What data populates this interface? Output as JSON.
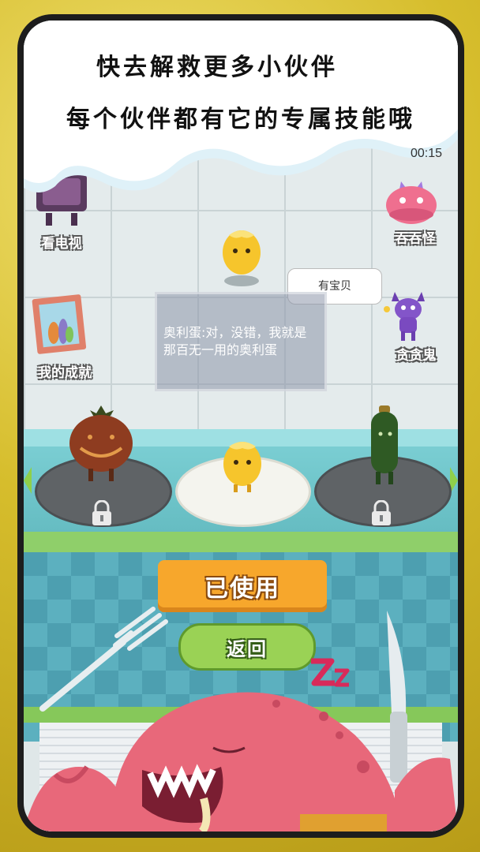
{
  "header": {
    "line1": "快去解救更多小伙伴",
    "line2": "每个伙伴都有它的专属技能哦"
  },
  "hud": {
    "timer": "00:15"
  },
  "side_menu": {
    "watch_tv": "看电视",
    "my_achievements": "我的成就",
    "swallow_monster": "吞吞怪",
    "stingy_ghost": "贪贪鬼"
  },
  "speech_bubble": {
    "text": "有宝贝"
  },
  "dialog": {
    "text": "奥利蛋:对，没错，我就是那百无一用的奥利蛋"
  },
  "buttons": {
    "used": "已使用",
    "back": "返回"
  },
  "colors": {
    "gold_frame": "#d6bd2c",
    "used_button": "#f7a72c",
    "back_button": "#9ad255",
    "monster": "#e8687a"
  }
}
